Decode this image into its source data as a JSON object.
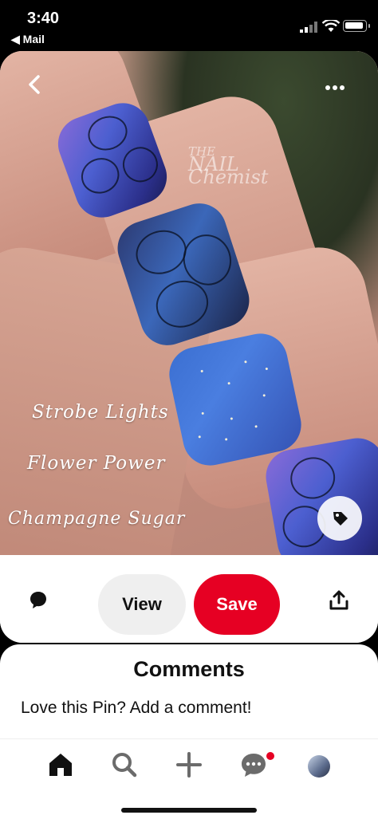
{
  "status_bar": {
    "time": "3:40",
    "back_app": "◀ Mail"
  },
  "pin": {
    "image_overlay_text": [
      "Strobe Lights",
      "Flower Power",
      "Champagne Sugar"
    ],
    "watermark": [
      "THE",
      "NAIL",
      "Chemist"
    ]
  },
  "actions": {
    "view_label": "View",
    "save_label": "Save"
  },
  "comments": {
    "title": "Comments",
    "prompt": "Love this Pin? Add a comment!"
  },
  "colors": {
    "save_red": "#e60023",
    "view_gray": "#efefef"
  },
  "icons": [
    "back-icon",
    "more-icon",
    "tag-icon",
    "comment-icon",
    "share-icon",
    "home-icon",
    "search-icon",
    "plus-icon",
    "messages-icon"
  ]
}
